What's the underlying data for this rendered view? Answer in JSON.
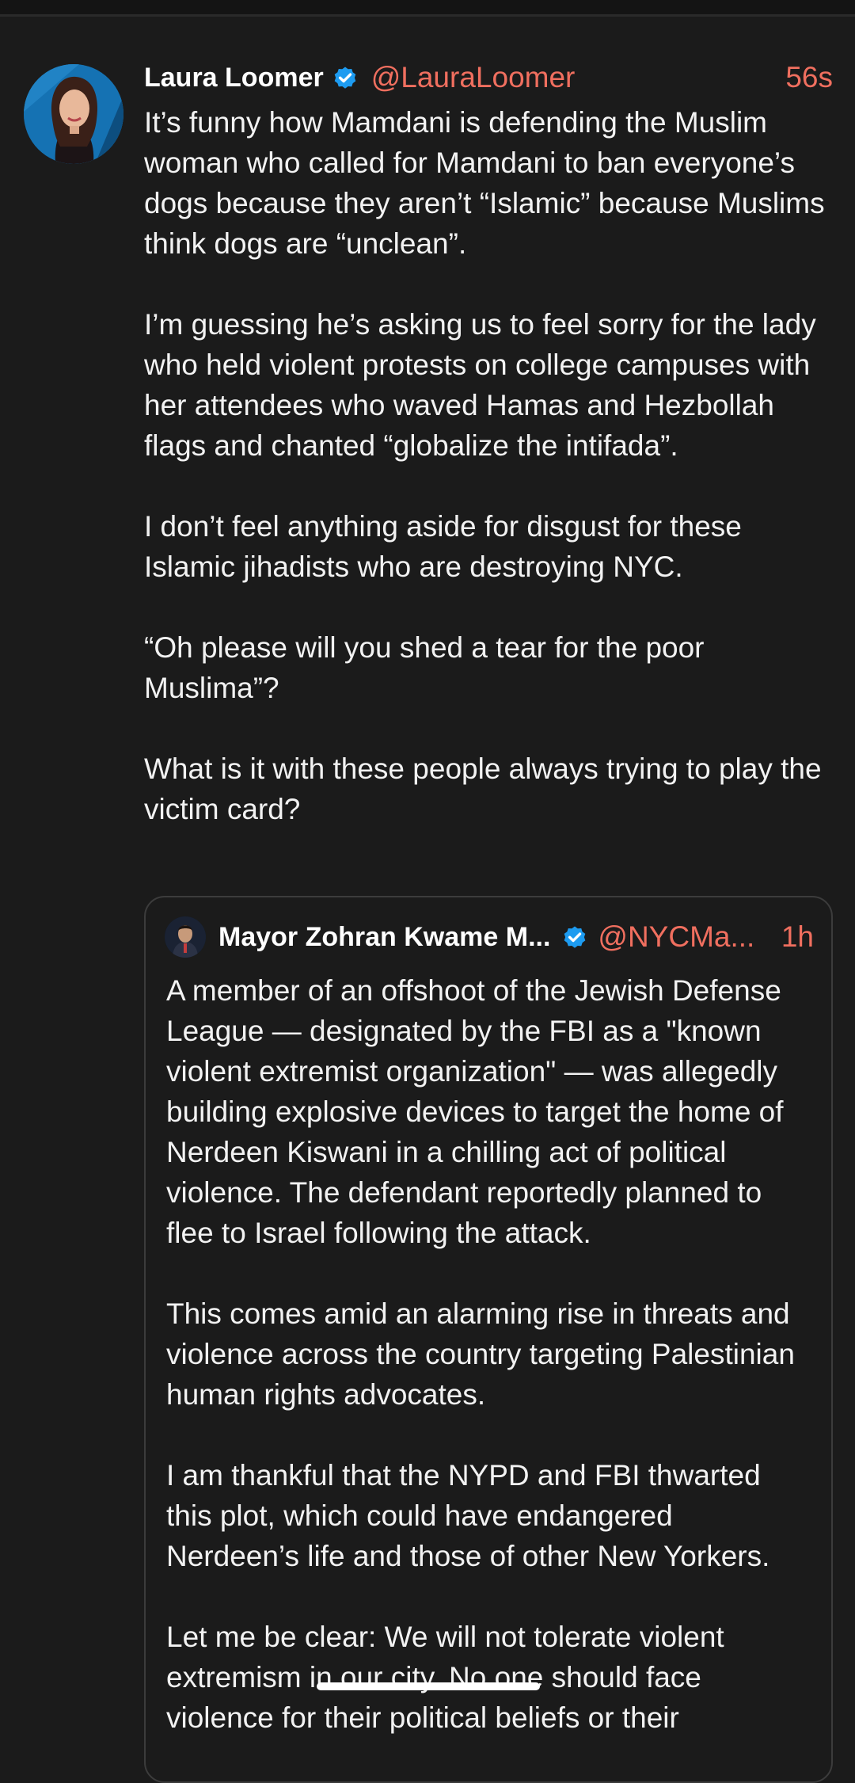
{
  "post": {
    "author": {
      "display_name": "Laura Loomer",
      "handle": "@LauraLoomer",
      "verified_icon": "verified-badge-icon",
      "avatar_icon": "avatar-image"
    },
    "time": "56s",
    "paragraphs": [
      "It’s funny how Mamdani is defending the Muslim woman who called for Mamdani to ban everyone’s dogs because they aren’t “Islamic” because Muslims think dogs are “unclean”.",
      "I’m guessing he’s asking us to feel sorry for the lady who held violent protests on college campuses with her attendees who waved Hamas and Hezbollah flags and chanted “globalize the intifada”.",
      "I don’t feel anything aside for disgust for these Islamic jihadists who are destroying  NYC.",
      "“Oh please will you shed a tear for the poor Muslima”?",
      "What is it with these people always trying to play the victim card?"
    ]
  },
  "quoted_post": {
    "author": {
      "display_name": "Mayor Zohran Kwame M...",
      "handle": "@NYCMa...",
      "verified_icon": "verified-badge-icon"
    },
    "time": "1h",
    "paragraphs": [
      "A member of an offshoot of the Jewish Defense League — designated by the FBI as a \"known violent extremist organization\" — was allegedly building explosive devices to target the home of Nerdeen Kiswani in a chilling act of political violence. The defendant reportedly planned to flee to Israel following the attack.",
      "This comes amid an alarming rise in threats and violence across the country targeting Palestinian human rights advocates.",
      "I am thankful that the NYPD and FBI thwarted this plot, which could have endangered Nerdeen’s life and those of other New Yorkers.",
      "Let me be clear: We will not tolerate violent extremism in our city. No one should face violence for their political beliefs or their"
    ]
  },
  "colors": {
    "background": "#1b1b1b",
    "accent": "#f06f5f",
    "verified": "#1d9bf0",
    "text": "#f2f2f2"
  }
}
